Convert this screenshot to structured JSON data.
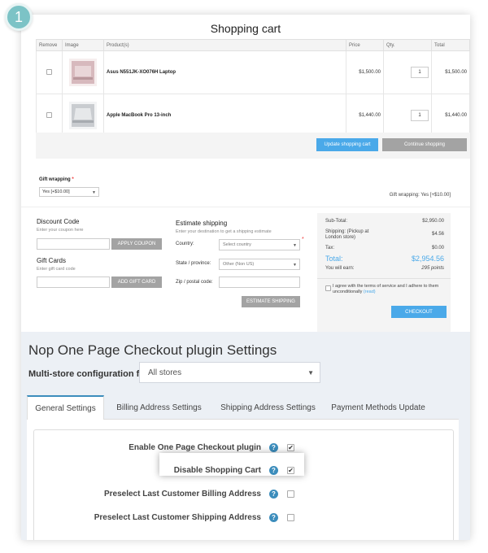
{
  "badge": {
    "number": "1"
  },
  "cart": {
    "title": "Shopping cart",
    "columns": [
      "Remove",
      "Image",
      "Product(s)",
      "Price",
      "Qty.",
      "Total"
    ],
    "items": [
      {
        "product": "Asus N551JK-XO076H Laptop",
        "price": "$1,500.00",
        "qty": "1",
        "total": "$1,500.00",
        "thumb_color": "#d7b9bd"
      },
      {
        "product": "Apple MacBook Pro 13-inch",
        "price": "$1,440.00",
        "qty": "1",
        "total": "$1,440.00",
        "thumb_color": "#c9ccd0"
      }
    ],
    "update_label": "Update shopping cart",
    "continue_label": "Continue shopping",
    "gift_wrapping_label": "Gift wrapping",
    "gift_wrapping_required": "*",
    "gift_wrapping_value": "Yes [+$10.00]",
    "gift_wrapping_summary": "Gift wrapping: Yes [+$10.00]",
    "discount": {
      "title": "Discount Code",
      "hint": "Enter your coupon here",
      "button": "APPLY COUPON"
    },
    "gift_cards": {
      "title": "Gift Cards",
      "hint": "Enter gift card code",
      "button": "ADD GIFT CARD"
    },
    "estimate": {
      "title": "Estimate shipping",
      "hint": "Enter your destination to get a shipping estimate",
      "country_label": "Country:",
      "country_value": "Select country",
      "country_required": "*",
      "state_label": "State / province:",
      "state_value": "Other (Non US)",
      "zip_label": "Zip / postal code:",
      "button": "ESTIMATE SHIPPING"
    },
    "totals": {
      "subtotal_label": "Sub-Total:",
      "subtotal_value": "$2,950.00",
      "shipping_label": "Shipping: (Pickup at London store)",
      "shipping_value": "$4.56",
      "tax_label": "Tax:",
      "tax_value": "$0.00",
      "total_label": "Total:",
      "total_value": "$2,954.56",
      "earn_label": "You will earn:",
      "earn_value": "295 points",
      "terms_text": "I agree with the terms of service and I adhere to them unconditionally",
      "terms_link": "(read)",
      "checkout_label": "CHECKOUT"
    }
  },
  "settings": {
    "title": "Nop One Page Checkout plugin Settings",
    "store_label": "Multi-store configuration for",
    "store_value": "All stores",
    "tabs": [
      "General Settings",
      "Billing Address Settings",
      "Shipping Address Settings",
      "Payment Methods Update"
    ],
    "options": [
      {
        "label": "Enable One Page Checkout plugin",
        "checked": true
      },
      {
        "label": "Disable Shopping Cart",
        "checked": true
      },
      {
        "label": "Preselect Last Customer Billing Address",
        "checked": false
      },
      {
        "label": "Preselect Last Customer Shipping Address",
        "checked": false
      }
    ],
    "help_glyph": "?",
    "check_glyph": "✔"
  },
  "colors": {
    "accent": "#4aa9e9",
    "admin_blue": "#3c8dbc",
    "badge": "#7cc3c6",
    "button_gray": "#a3a3a3"
  }
}
